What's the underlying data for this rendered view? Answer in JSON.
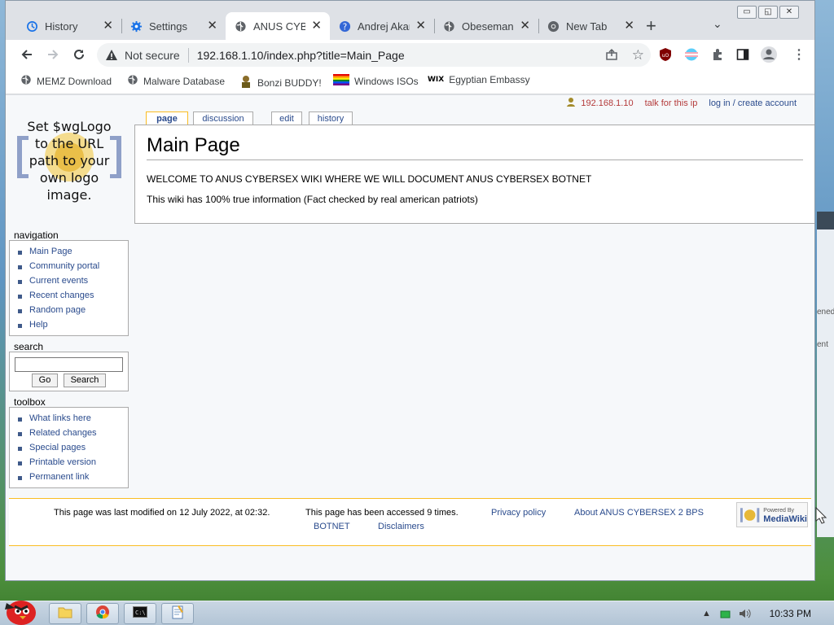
{
  "browser": {
    "tabs": [
      {
        "label": "History",
        "icon": "history-icon"
      },
      {
        "label": "Settings",
        "icon": "gear-icon"
      },
      {
        "label": "ANUS CYBE",
        "icon": "globe-icon",
        "active": true
      },
      {
        "label": "Andrej Akar",
        "icon": "question-icon"
      },
      {
        "label": "Obeseman.",
        "icon": "globe-icon"
      },
      {
        "label": "New Tab",
        "icon": "chrome-icon"
      }
    ],
    "new_tab_symbol": "+",
    "window_controls": [
      "▭",
      "◱",
      "✕"
    ],
    "security_label": "Not secure",
    "url": "192.168.1.10/index.php?title=Main_Page",
    "bookmarks": [
      "MEMZ Download",
      "Malware Database",
      "Bonzi BUDDY!",
      "Windows ISOs",
      "Egyptian Embassy"
    ]
  },
  "wiki": {
    "personal": {
      "ip": "192.168.1.10",
      "talk": "talk for this ip",
      "login": "log in / create account"
    },
    "logo_text": "Set $wgLogo to the URL path to your own logo image.",
    "tabs": {
      "page": "page",
      "discussion": "discussion",
      "edit": "edit",
      "history": "history"
    },
    "title": "Main Page",
    "para1": "WELCOME TO ANUS CYBERSEX WIKI WHERE WE WILL DOCUMENT ANUS CYBERSEX BOTNET",
    "para2": "This wiki has 100% true information (Fact checked by real american patriots)",
    "navigation": {
      "heading": "navigation",
      "items": [
        "Main Page",
        "Community portal",
        "Current events",
        "Recent changes",
        "Random page",
        "Help"
      ]
    },
    "search": {
      "heading": "search",
      "go": "Go",
      "search": "Search"
    },
    "toolbox": {
      "heading": "toolbox",
      "items": [
        "What links here",
        "Related changes",
        "Special pages",
        "Printable version",
        "Permanent link"
      ]
    },
    "footer": {
      "lastmod": "This page was last modified on 12 July 2022, at 02:32.",
      "viewcount": "This page has been accessed 9 times.",
      "privacy": "Privacy policy",
      "about1": "About ANUS CYBERSEX 2 BPS",
      "about2": "BOTNET",
      "disclaimers": "Disclaimers",
      "powered_line1": "Powered By",
      "powered_line2": "MediaWiki"
    }
  },
  "desktop": {
    "side_text1": "ened",
    "side_text2": "ent"
  },
  "taskbar": {
    "time": "10:33 PM"
  }
}
